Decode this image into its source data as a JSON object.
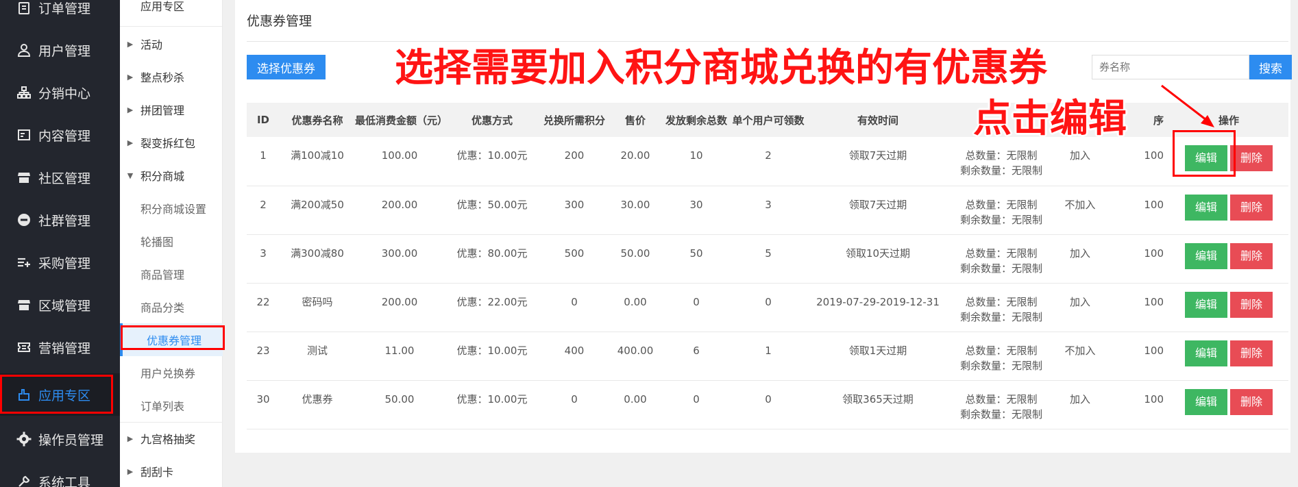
{
  "sidebar": {
    "items": [
      {
        "label": "订单管理",
        "icon": "clipboard-icon"
      },
      {
        "label": "用户管理",
        "icon": "user-icon"
      },
      {
        "label": "分销中心",
        "icon": "hierarchy-icon"
      },
      {
        "label": "内容管理",
        "icon": "content-icon"
      },
      {
        "label": "社区管理",
        "icon": "store-icon"
      },
      {
        "label": "社群管理",
        "icon": "minus-circle-icon"
      },
      {
        "label": "采购管理",
        "icon": "list-add-icon"
      },
      {
        "label": "区域管理",
        "icon": "store-icon"
      },
      {
        "label": "营销管理",
        "icon": "ticket-icon"
      },
      {
        "label": "应用专区",
        "icon": "app-icon"
      },
      {
        "label": "操作员管理",
        "icon": "gear-icon"
      },
      {
        "label": "系统工具",
        "icon": "tool-icon"
      }
    ]
  },
  "submenu": {
    "header": "应用专区",
    "items": [
      {
        "label": "活动"
      },
      {
        "label": "整点秒杀"
      },
      {
        "label": "拼团管理"
      },
      {
        "label": "裂变拆红包"
      },
      {
        "label": "积分商城"
      },
      {
        "label": "积分商城设置"
      },
      {
        "label": "轮播图"
      },
      {
        "label": "商品管理"
      },
      {
        "label": "商品分类"
      },
      {
        "label": "优惠券管理"
      },
      {
        "label": "用户兑换券"
      },
      {
        "label": "订单列表"
      },
      {
        "label": "九宫格抽奖"
      },
      {
        "label": "刮刮卡"
      }
    ]
  },
  "main": {
    "title": "优惠券管理",
    "select_button": "选择优惠券",
    "search_placeholder": "券名称",
    "search_button": "搜索"
  },
  "table": {
    "headers": [
      "ID",
      "优惠券名称",
      "最低消费金额（元）",
      "优惠方式",
      "兑换所需积分",
      "售价",
      "发放剩余总数",
      "单个用户可领数",
      "有效时间",
      "",
      "",
      "序",
      "操作"
    ],
    "rows": [
      {
        "id": "1",
        "name": "满100减10",
        "min": "100.00",
        "discount": "优惠：10.00元",
        "points": "200",
        "price": "20.00",
        "remain": "10",
        "per_user": "2",
        "valid": "领取7天过期",
        "total": "总数量：无限制",
        "left": "剩余数量：无限制",
        "join": "加入",
        "sort": "100"
      },
      {
        "id": "2",
        "name": "满200减50",
        "min": "200.00",
        "discount": "优惠：50.00元",
        "points": "300",
        "price": "30.00",
        "remain": "30",
        "per_user": "3",
        "valid": "领取7天过期",
        "total": "总数量：无限制",
        "left": "剩余数量：无限制",
        "join": "不加入",
        "sort": "100"
      },
      {
        "id": "3",
        "name": "满300减80",
        "min": "300.00",
        "discount": "优惠：80.00元",
        "points": "500",
        "price": "50.00",
        "remain": "50",
        "per_user": "5",
        "valid": "领取10天过期",
        "total": "总数量：无限制",
        "left": "剩余数量：无限制",
        "join": "加入",
        "sort": "100"
      },
      {
        "id": "22",
        "name": "密码吗",
        "min": "200.00",
        "discount": "优惠：22.00元",
        "points": "0",
        "price": "0.00",
        "remain": "0",
        "per_user": "0",
        "valid": "2019-07-29-2019-12-31",
        "total": "总数量：无限制",
        "left": "剩余数量：无限制",
        "join": "加入",
        "sort": "100"
      },
      {
        "id": "23",
        "name": "测试",
        "min": "11.00",
        "discount": "优惠：10.00元",
        "points": "400",
        "price": "400.00",
        "remain": "6",
        "per_user": "1",
        "valid": "领取1天过期",
        "total": "总数量：无限制",
        "left": "剩余数量：无限制",
        "join": "不加入",
        "sort": "100"
      },
      {
        "id": "30",
        "name": "优惠券",
        "min": "50.00",
        "discount": "优惠：10.00元",
        "points": "0",
        "price": "0.00",
        "remain": "0",
        "per_user": "0",
        "valid": "领取365天过期",
        "total": "总数量：无限制",
        "left": "剩余数量：无限制",
        "join": "加入",
        "sort": "100"
      }
    ],
    "edit_label": "编辑",
    "delete_label": "删除"
  },
  "annotation": {
    "line1": "选择需要加入积分商城兑换的有优惠券",
    "line2": "点击编辑"
  },
  "colors": {
    "primary": "#2d8cf0",
    "success": "#3eb762",
    "danger": "#e84c55",
    "annotation": "#ff1414"
  }
}
